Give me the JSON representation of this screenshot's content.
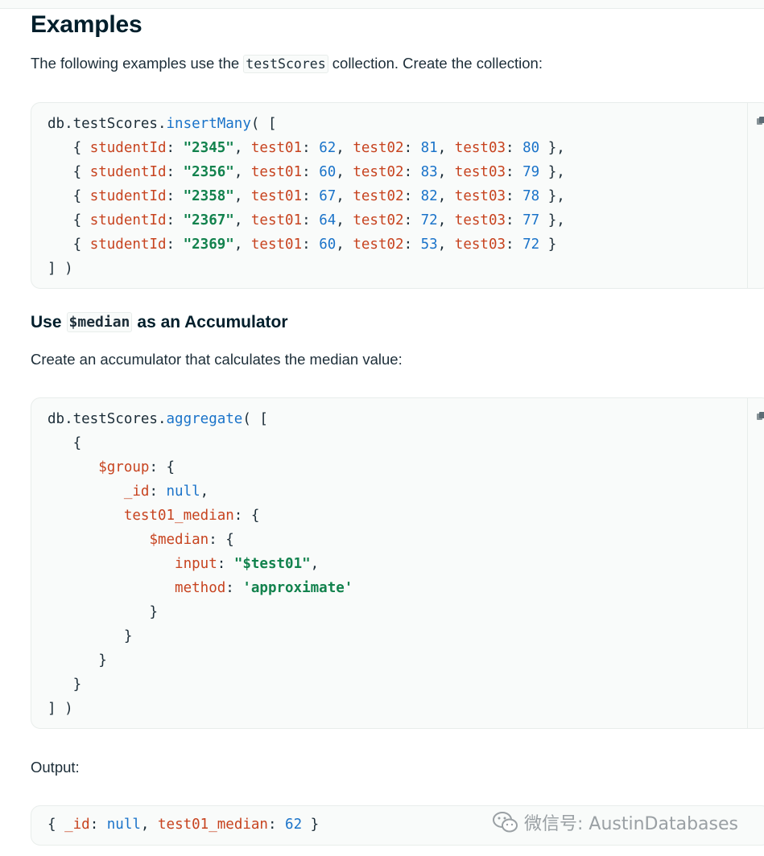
{
  "headings": {
    "examples": "Examples",
    "use_median_prefix": "Use",
    "use_median_code": "$median",
    "use_median_suffix": "as an Accumulator"
  },
  "intro": {
    "before": "The following examples use the",
    "code": "testScores",
    "after": "collection. Create the collection:"
  },
  "accumulator_text": "Create an accumulator that calculates the median value:",
  "output_label": "Output:",
  "insert_block": {
    "open": {
      "obj": "db.testScores.",
      "fn": "insertMany",
      "rest": "( ["
    },
    "rows": [
      {
        "id": "\"2345\"",
        "t1": "62",
        "t2": "81",
        "t3": "80",
        "end": " },"
      },
      {
        "id": "\"2356\"",
        "t1": "60",
        "t2": "83",
        "t3": "79",
        "end": " },"
      },
      {
        "id": "\"2358\"",
        "t1": "67",
        "t2": "82",
        "t3": "78",
        "end": " },"
      },
      {
        "id": "\"2367\"",
        "t1": "64",
        "t2": "72",
        "t3": "77",
        "end": " },"
      },
      {
        "id": "\"2369\"",
        "t1": "60",
        "t2": "53",
        "t3": "72",
        "end": " }"
      }
    ],
    "close": "] )",
    "keys": {
      "studentId": "studentId",
      "test01": "test01",
      "test02": "test02",
      "test03": "test03"
    }
  },
  "aggregate_block": {
    "open": {
      "obj": "db.testScores.",
      "fn": "aggregate",
      "rest": "( ["
    },
    "brace_open": "{",
    "group_key": "$group",
    "id_key": "_id",
    "null_value": "null",
    "median_field": "test01_median",
    "median_key": "$median",
    "input_key": "input",
    "input_value": "\"$test01\"",
    "method_key": "method",
    "method_value": "'approximate'",
    "brace_close": "}",
    "close": "] )"
  },
  "output_block": {
    "id_key": "_id",
    "null_value": "null",
    "median_field": "test01_median",
    "median_value": "62"
  },
  "watermark": "微信号: AustinDatabases",
  "icons": {
    "copy": "copy-icon",
    "wechat": "wechat-icon"
  }
}
